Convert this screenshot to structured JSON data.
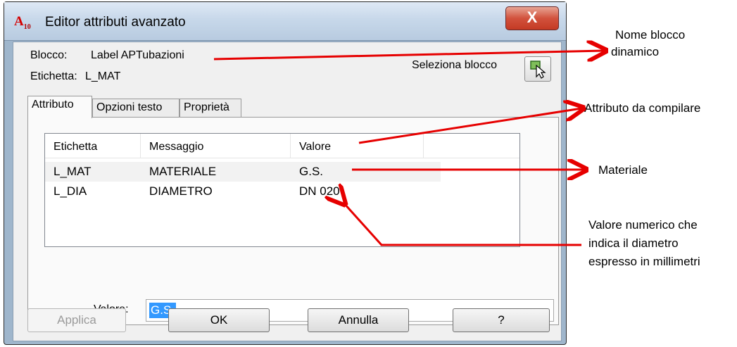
{
  "window": {
    "icon_text": "A",
    "icon_sub": "10",
    "title": "Editor attributi avanzato",
    "close_label": "X"
  },
  "info": {
    "blocco_label": "Blocco:",
    "blocco_value": "Label APTubazioni",
    "etichetta_label": "Etichetta:",
    "etichetta_value": "L_MAT",
    "seleziona_label": "Seleziona blocco"
  },
  "tabs": [
    {
      "label": "Attributo",
      "active": true
    },
    {
      "label": "Opzioni testo",
      "active": false
    },
    {
      "label": "Proprietà",
      "active": false
    }
  ],
  "table": {
    "columns": [
      "Etichetta",
      "Messaggio",
      "Valore"
    ],
    "rows": [
      {
        "etichetta": "L_MAT",
        "messaggio": "MATERIALE",
        "valore": "G.S.",
        "selected": true
      },
      {
        "etichetta": "L_DIA",
        "messaggio": "DIAMETRO",
        "valore": "DN 020",
        "selected": false
      }
    ]
  },
  "valore_field": {
    "label": "Valore:",
    "value": "G.S."
  },
  "buttons": {
    "applica": "Applica",
    "ok": "OK",
    "annulla": "Annulla",
    "help": "?"
  },
  "annotations": {
    "nome_blocco_line1": "Nome blocco",
    "nome_blocco_line2": "dinamico",
    "attributo": "Attributo da compilare",
    "materiale": "Materiale",
    "valore_line1": "Valore numerico che",
    "valore_line2": "indica il diametro",
    "valore_line3": "espresso in millimetri"
  },
  "colors": {
    "arrow": "#e60000",
    "selection": "#3399ff",
    "close_button": "#c43a24"
  }
}
